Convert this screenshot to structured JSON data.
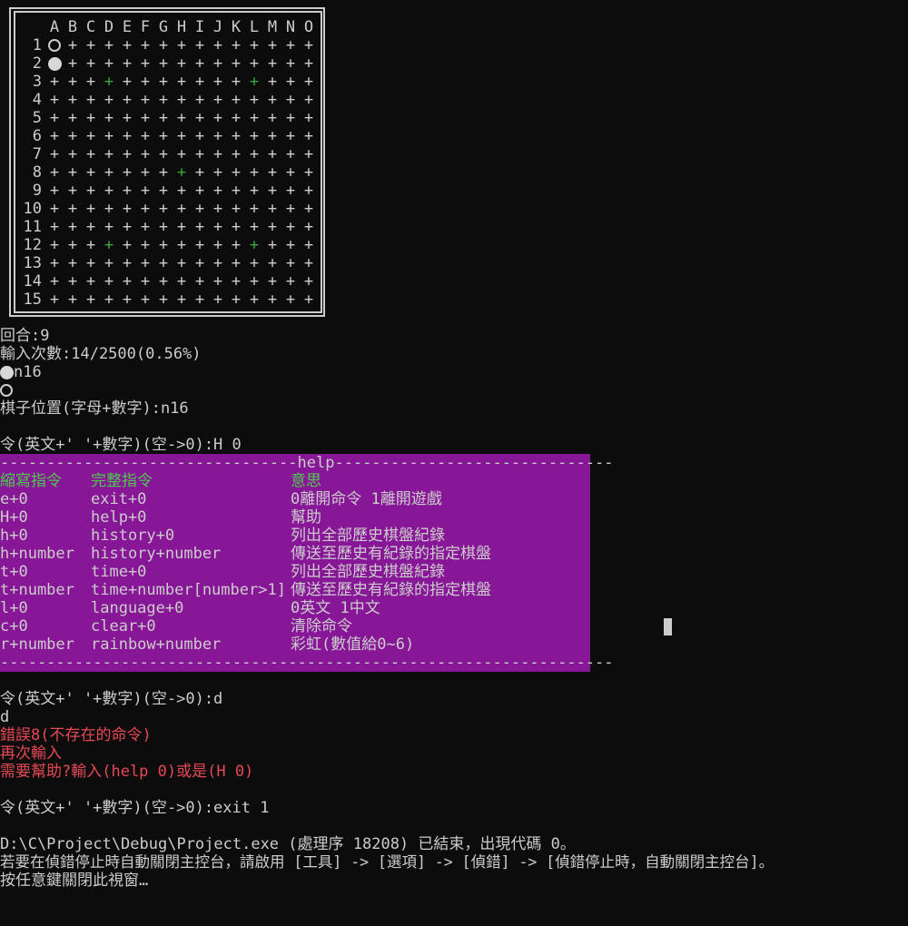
{
  "board": {
    "columns": [
      "A",
      "B",
      "C",
      "D",
      "E",
      "F",
      "G",
      "H",
      "I",
      "J",
      "K",
      "L",
      "M",
      "N",
      "O"
    ],
    "rows": [
      "1",
      "2",
      "3",
      "4",
      "5",
      "6",
      "7",
      "8",
      "9",
      "10",
      "11",
      "12",
      "13",
      "14",
      "15"
    ],
    "point_glyph": "+",
    "star_points": [
      "D3",
      "L3",
      "H8",
      "D12",
      "L12"
    ],
    "stones": [
      {
        "pos": "A1",
        "style": "ring-icon"
      },
      {
        "pos": "A2",
        "style": "filled-circle-icon"
      }
    ],
    "colors": {
      "grid": "#cccccc",
      "star": "#3aa63a",
      "stone": "#d8d8d8"
    }
  },
  "status": {
    "round": "回合:9",
    "input_count": "輸入次數:14/2500(0.56%)",
    "last_move": "n16",
    "position_prompt": "棋子位置(字母+數字):n16"
  },
  "command1": "令(英文+' '+數字)(空->0):H 0",
  "help": {
    "top_rule": "--------------------------------help------------------------------",
    "bottom_rule": "------------------------------------------------------------------",
    "headers": {
      "short": "縮寫指令",
      "full": "完整指令",
      "meaning": "意思"
    },
    "rows": [
      {
        "short": "e+0",
        "full": "exit+0",
        "meaning": "0離開命令 1離開遊戲"
      },
      {
        "short": "H+0",
        "full": "help+0",
        "meaning": "幫助"
      },
      {
        "short": "h+0",
        "full": "history+0",
        "meaning": "列出全部歷史棋盤紀錄"
      },
      {
        "short": "h+number",
        "full": "history+number",
        "meaning": "傳送至歷史有紀錄的指定棋盤"
      },
      {
        "short": "t+0",
        "full": "time+0",
        "meaning": "列出全部歷史棋盤紀錄"
      },
      {
        "short": "t+number",
        "full": "time+number[number>1]",
        "meaning": "傳送至歷史有紀錄的指定棋盤"
      },
      {
        "short": "l+0",
        "full": "language+0",
        "meaning": "0英文 1中文"
      },
      {
        "short": "c+0",
        "full": "clear+0",
        "meaning": "清除命令"
      },
      {
        "short": "r+number",
        "full": "rainbow+number",
        "meaning": "彩虹(數值給0~6)"
      }
    ],
    "colors": {
      "background": "#881798",
      "header": "#4ec94e"
    }
  },
  "command2": "令(英文+' '+數字)(空->0):d",
  "echo": "d",
  "error": {
    "line1": "錯誤8(不存在的命令)",
    "line2": "再次輸入",
    "line3": "需要幫助?輸入(help 0)或是(H 0)",
    "color": "#e74856"
  },
  "command3": "令(英文+' '+數字)(空->0):exit 1",
  "footer": {
    "line1": "D:\\C\\Project\\Debug\\Project.exe (處理序 18208) 已結束，出現代碼 0。",
    "line2": "若要在偵錯停止時自動關閉主控台，請啟用 [工具] -> [選項] -> [偵錯] -> [偵錯停止時，自動關閉主控台]。",
    "line3": "按任意鍵關閉此視窗…"
  }
}
